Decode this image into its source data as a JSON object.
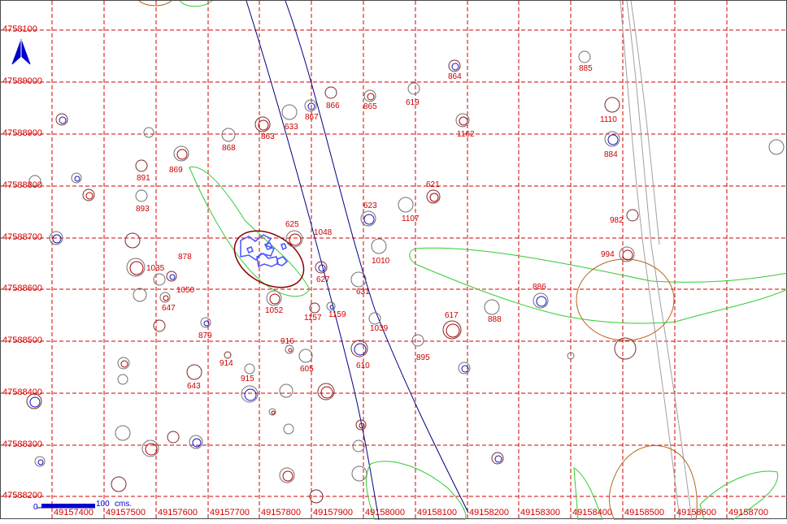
{
  "map": {
    "grid": {
      "y_labels": [
        "4758100",
        "47589000",
        "47588900",
        "47588800",
        "47588700",
        "47588600",
        "47588500",
        "47588400",
        "47588300",
        "47588200"
      ],
      "x_labels": [
        "49157400",
        "49157500",
        "49157600",
        "49157700",
        "49157800",
        "49157900",
        "49158000",
        "49158100",
        "49158200",
        "49158300",
        "49158400",
        "49158500",
        "49158600",
        "49158700"
      ],
      "line_color": "#d40000",
      "label_color": "#d40000"
    },
    "north_arrow": {
      "icon": "north-arrow-icon",
      "color": "#0000cc"
    },
    "scale_bar": {
      "zero_label": "0",
      "end_label": "100",
      "unit_label": "cms."
    },
    "labels": [
      {
        "text": "864",
        "col": "red"
      },
      {
        "text": "885",
        "col": "red"
      },
      {
        "text": "866",
        "col": "red"
      },
      {
        "text": "865",
        "col": "red"
      },
      {
        "text": "619",
        "col": "red"
      },
      {
        "text": "867",
        "col": "red"
      },
      {
        "text": "633",
        "col": "red"
      },
      {
        "text": "863",
        "col": "red"
      },
      {
        "text": "1162",
        "col": "red"
      },
      {
        "text": "1110",
        "col": "red"
      },
      {
        "text": "868",
        "col": "red"
      },
      {
        "text": "884",
        "col": "red"
      },
      {
        "text": "869",
        "col": "red"
      },
      {
        "text": "891",
        "col": "red"
      },
      {
        "text": "621",
        "col": "red"
      },
      {
        "text": "893",
        "col": "red"
      },
      {
        "text": "623",
        "col": "red"
      },
      {
        "text": "1107",
        "col": "red"
      },
      {
        "text": "982",
        "col": "red"
      },
      {
        "text": "625",
        "col": "red"
      },
      {
        "text": "1048",
        "col": "red"
      },
      {
        "text": "878",
        "col": "red"
      },
      {
        "text": "1010",
        "col": "red"
      },
      {
        "text": "994",
        "col": "red"
      },
      {
        "text": "1035",
        "col": "red"
      },
      {
        "text": "627",
        "col": "red"
      },
      {
        "text": "1050",
        "col": "red"
      },
      {
        "text": "631",
        "col": "red"
      },
      {
        "text": "886",
        "col": "red"
      },
      {
        "text": "647",
        "col": "red"
      },
      {
        "text": "1052",
        "col": "red"
      },
      {
        "text": "1157",
        "col": "red"
      },
      {
        "text": "1159",
        "col": "red"
      },
      {
        "text": "617",
        "col": "red"
      },
      {
        "text": "888",
        "col": "red"
      },
      {
        "text": "879",
        "col": "red"
      },
      {
        "text": "1039",
        "col": "red"
      },
      {
        "text": "916",
        "col": "red"
      },
      {
        "text": "895",
        "col": "red"
      },
      {
        "text": "914",
        "col": "red"
      },
      {
        "text": "605",
        "col": "red"
      },
      {
        "text": "610",
        "col": "red"
      },
      {
        "text": "915",
        "col": "red"
      },
      {
        "text": "643",
        "col": "red"
      }
    ],
    "colors": {
      "feature_outline": "#7a7a7a",
      "feature_red": "#b00000",
      "feature_blue": "#1010c0",
      "green_outline": "#33cc33",
      "brown_outline": "#b5651d",
      "navy_line": "#000080",
      "road_gray": "#a0a0a0",
      "fill_blue": "#4455ff"
    }
  }
}
